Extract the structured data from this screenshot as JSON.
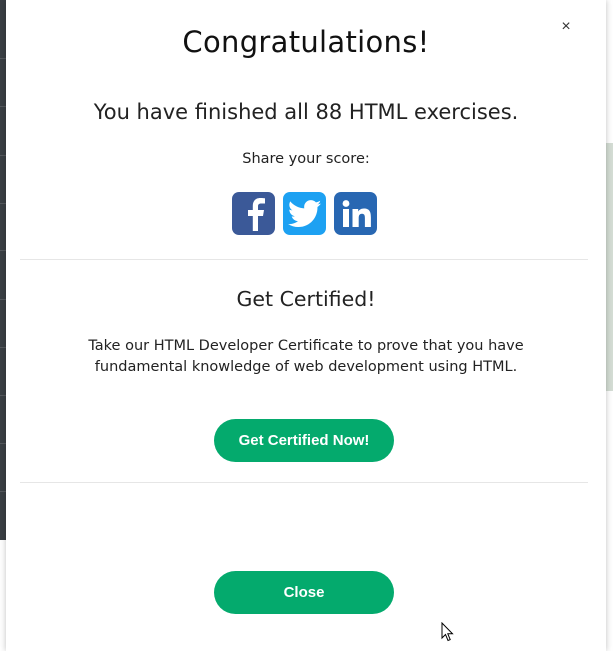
{
  "modal": {
    "close_symbol": "×",
    "title": "Congratulations!",
    "subtitle": "You have finished all 88 HTML exercises.",
    "share_label": "Share your score:",
    "share_icons": [
      {
        "name": "facebook-icon",
        "color": "#3b5998"
      },
      {
        "name": "twitter-icon",
        "color": "#1da1f2"
      },
      {
        "name": "linkedin-icon",
        "color": "#2867b2"
      }
    ],
    "cert_title": "Get Certified!",
    "cert_text_line1": "Take our HTML Developer Certificate to prove that you have",
    "cert_text_line2": "fundamental knowledge of web development using HTML.",
    "cert_button": "Get Certified Now!",
    "close_button": "Close",
    "accent_color": "#04aa6d"
  }
}
